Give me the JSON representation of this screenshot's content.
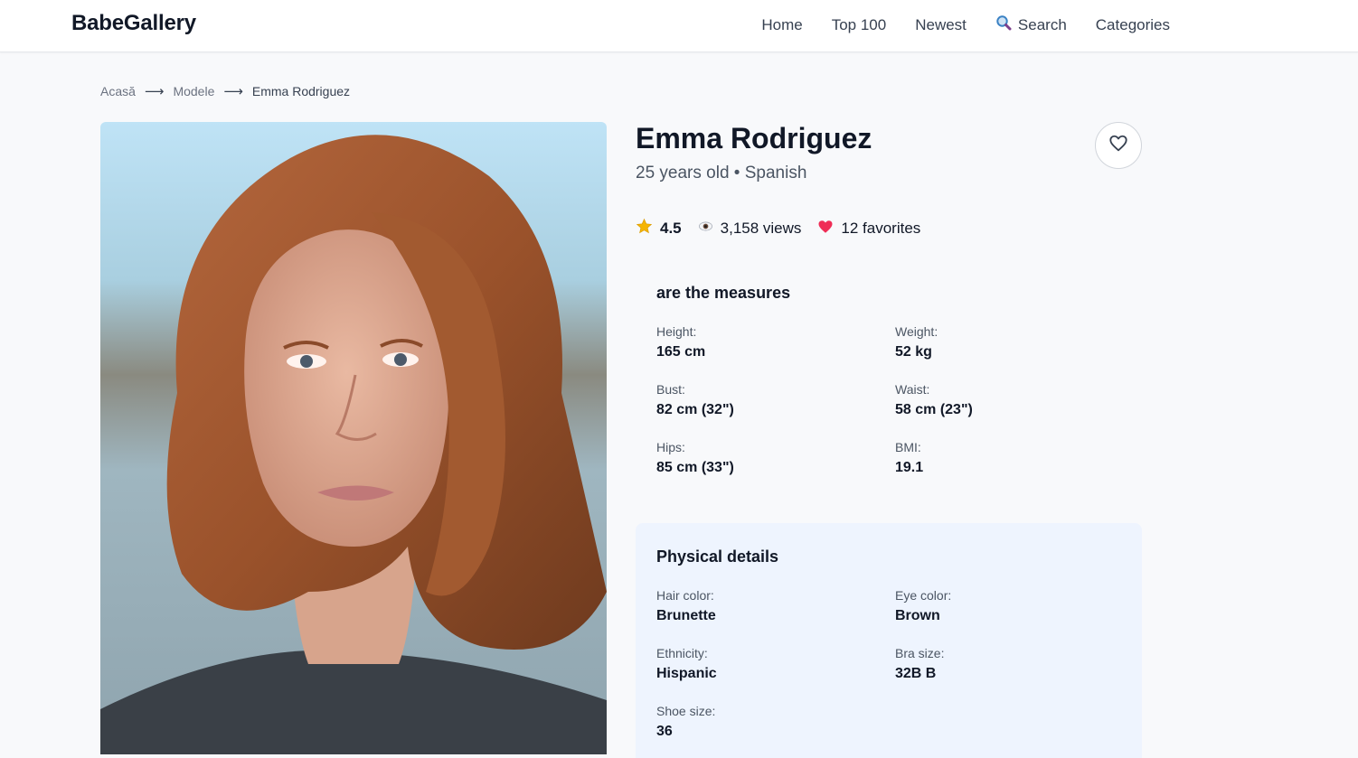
{
  "header": {
    "brand": "BabeGallery",
    "nav": [
      {
        "label": "Home",
        "icon": ""
      },
      {
        "label": "Top 100",
        "icon": ""
      },
      {
        "label": "Newest",
        "icon": ""
      },
      {
        "label": "Search",
        "icon": "search-icon"
      },
      {
        "label": "Categories",
        "icon": ""
      }
    ]
  },
  "breadcrumb": {
    "items": [
      "Acasă",
      "Modele",
      "Emma Rodriguez"
    ],
    "separator": "⟶"
  },
  "profile": {
    "name": "Emma Rodriguez",
    "age": "25 years old",
    "dot": "•",
    "nationality": "Spanish",
    "rating": "4.5",
    "views": "3,158 views",
    "favorites": "12 favorites"
  },
  "measures": {
    "title": "are the measures",
    "items": [
      {
        "label": "Height:",
        "value": "165 cm"
      },
      {
        "label": "Weight:",
        "value": "52 kg"
      },
      {
        "label": "Bust:",
        "value": "82 cm (32\")"
      },
      {
        "label": "Waist:",
        "value": "58 cm (23\")"
      },
      {
        "label": "Hips:",
        "value": "85 cm (33\")"
      },
      {
        "label": "BMI:",
        "value": "19.1"
      }
    ]
  },
  "physical": {
    "title": "Physical details",
    "items": [
      {
        "label": "Hair color:",
        "value": "Brunette"
      },
      {
        "label": "Eye color:",
        "value": "Brown"
      },
      {
        "label": "Ethnicity:",
        "value": "Hispanic"
      },
      {
        "label": "Bra size:",
        "value": "32B B"
      },
      {
        "label": "Shoe size:",
        "value": "36"
      }
    ]
  },
  "colors": {
    "background": "#f8f9fb",
    "physical_panel": "#eef4fe",
    "heart": "#ef2d56",
    "star": "#f5b400"
  }
}
